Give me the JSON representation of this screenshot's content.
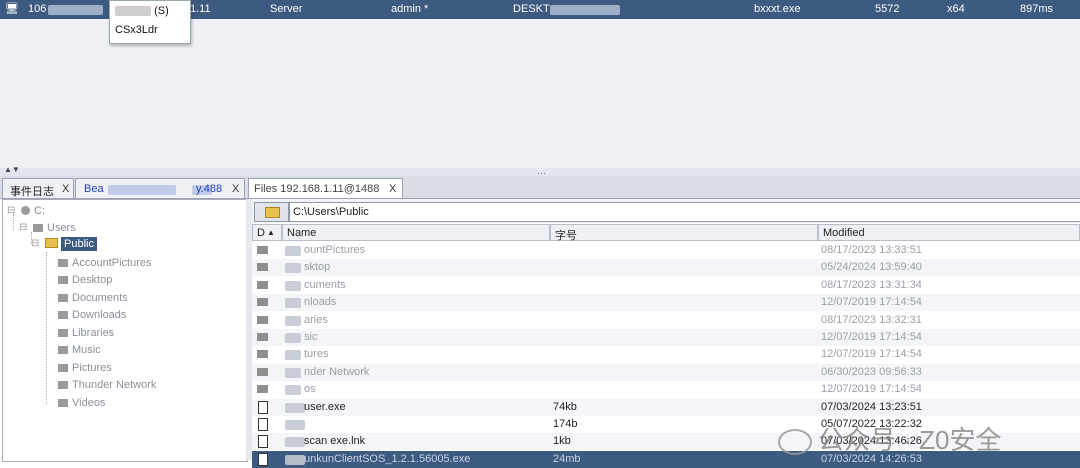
{
  "sessions": {
    "row": {
      "ip": "106",
      "lan": "1.11",
      "type": "Server",
      "user": "admin *",
      "host": "DESKT",
      "process": "bxxxt.exe",
      "pid": "5572",
      "arch": "x64",
      "latency": "897ms"
    },
    "context_menu": {
      "item_partial": "(S)",
      "item2": "CSx3Ldr"
    }
  },
  "tabs": [
    {
      "label": "事件日志",
      "close": "X"
    },
    {
      "label": "Bea",
      "suffix": "y.488",
      "close": "X"
    },
    {
      "label": "Files 192.168.1.11@1488",
      "close": "X"
    }
  ],
  "tree": {
    "root": "C:",
    "users": "Users",
    "selected": "Public",
    "children": [
      "AccountPictures",
      "Desktop",
      "Documents",
      "Downloads",
      "Libraries",
      "Music",
      "Pictures",
      "Thunder Network",
      "Videos"
    ]
  },
  "path": "C:\\Users\\Public",
  "table": {
    "headers": {
      "d": "D",
      "name": "Name",
      "size": "字号",
      "modified": "Modified"
    },
    "rows": [
      {
        "kind": "dir",
        "name": "ountPictures",
        "size": "",
        "modified": "08/17/2023 13:33:51"
      },
      {
        "kind": "dir",
        "name": "sktop",
        "size": "",
        "modified": "05/24/2024 13:59:40"
      },
      {
        "kind": "dir",
        "name": "cuments",
        "size": "",
        "modified": "08/17/2023 13:31:34"
      },
      {
        "kind": "dir",
        "name": "nloads",
        "size": "",
        "modified": "12/07/2019 17:14:54"
      },
      {
        "kind": "dir",
        "name": "aries",
        "size": "",
        "modified": "08/17/2023 13:32:31"
      },
      {
        "kind": "dir",
        "name": "sic",
        "size": "",
        "modified": "12/07/2019 17:14:54"
      },
      {
        "kind": "dir",
        "name": "tures",
        "size": "",
        "modified": "12/07/2019 17:14:54"
      },
      {
        "kind": "dir",
        "name": "nder Network",
        "size": "",
        "modified": "06/30/2023 09:56:33"
      },
      {
        "kind": "dir",
        "name": "os",
        "size": "",
        "modified": "12/07/2019 17:14:54"
      },
      {
        "kind": "file",
        "name": "user.exe",
        "size": "74kb",
        "modified": "07/03/2024 13:23:51"
      },
      {
        "kind": "file",
        "name": "",
        "size": "174b",
        "modified": "05/07/2022 13:22:32"
      },
      {
        "kind": "file",
        "name": "scan  exe.lnk",
        "size": "1kb",
        "modified": "07/03/2024 13:46:26"
      },
      {
        "kind": "file",
        "name": "unkunClientSOS_1.2.1.56005.exe",
        "size": "24mb",
        "modified": "07/03/2024 14:26:53"
      }
    ]
  },
  "watermark": "公众号 · Z0安全",
  "colors": {
    "accent": "#3d5a80",
    "panel": "#eef0f6"
  }
}
